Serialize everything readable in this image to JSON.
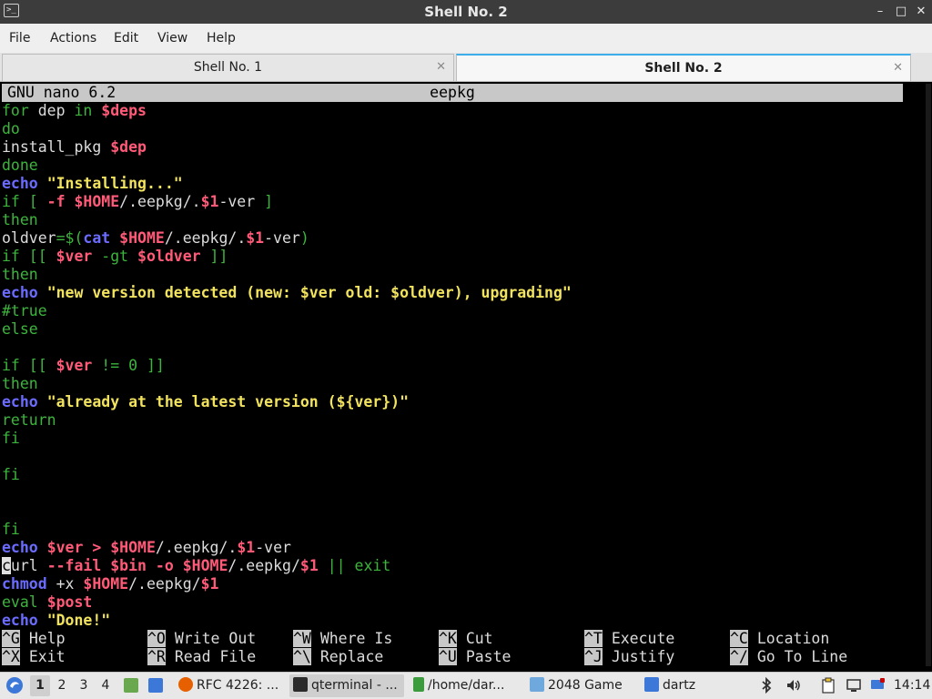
{
  "window": {
    "title": "Shell No. 2",
    "controls": {
      "minimize": "–",
      "maximize": "□",
      "close": "✕"
    }
  },
  "menu": [
    "File",
    "Actions",
    "Edit",
    "View",
    "Help"
  ],
  "tabs": [
    {
      "label": "Shell No. 1",
      "active": false
    },
    {
      "label": "Shell No. 2",
      "active": true
    }
  ],
  "nano": {
    "version_label": "GNU nano 6.2",
    "filename": "eepkg",
    "lines": [
      [
        [
          "for",
          "kw"
        ],
        [
          " dep ",
          "plain"
        ],
        [
          "in",
          "kw"
        ],
        [
          " ",
          "plain"
        ],
        [
          "$deps",
          "var"
        ]
      ],
      [
        [
          "do",
          "kw"
        ]
      ],
      [
        [
          "install_pkg ",
          "plain"
        ],
        [
          "$dep",
          "var"
        ]
      ],
      [
        [
          "done",
          "kw"
        ]
      ],
      [
        [
          "echo",
          "blue"
        ],
        [
          " ",
          "plain"
        ],
        [
          "\"Installing...\"",
          "str"
        ]
      ],
      [
        [
          "if [ ",
          "kw"
        ],
        [
          "-f",
          "red"
        ],
        [
          " ",
          "plain"
        ],
        [
          "$HOME",
          "var"
        ],
        [
          "/.eepkg/.",
          "plain"
        ],
        [
          "$1",
          "var"
        ],
        [
          "-ver ",
          "plain"
        ],
        [
          "]",
          "kw"
        ]
      ],
      [
        [
          "then",
          "kw"
        ]
      ],
      [
        [
          "oldver",
          "plain"
        ],
        [
          "=$(",
          "kw"
        ],
        [
          "cat",
          "blue"
        ],
        [
          " ",
          "plain"
        ],
        [
          "$HOME",
          "var"
        ],
        [
          "/.eepkg/.",
          "plain"
        ],
        [
          "$1",
          "var"
        ],
        [
          "-ver",
          "plain"
        ],
        [
          ")",
          "kw"
        ]
      ],
      [
        [
          "if [[ ",
          "kw"
        ],
        [
          "$ver",
          "var"
        ],
        [
          " -gt ",
          "kw"
        ],
        [
          "$oldver",
          "var"
        ],
        [
          " ]]",
          "kw"
        ]
      ],
      [
        [
          "then",
          "kw"
        ]
      ],
      [
        [
          "echo",
          "blue"
        ],
        [
          " ",
          "plain"
        ],
        [
          "\"new version detected (new: $ver old: $oldver), upgrading\"",
          "str"
        ]
      ],
      [
        [
          "#true",
          "kw"
        ]
      ],
      [
        [
          "else",
          "kw"
        ]
      ],
      [],
      [
        [
          "if [[ ",
          "kw"
        ],
        [
          "$ver",
          "var"
        ],
        [
          " != 0 ]]",
          "kw"
        ]
      ],
      [
        [
          "then",
          "kw"
        ]
      ],
      [
        [
          "echo",
          "blue"
        ],
        [
          " ",
          "plain"
        ],
        [
          "\"already at the latest version (${ver})\"",
          "str"
        ]
      ],
      [
        [
          "return",
          "kw"
        ]
      ],
      [
        [
          "fi",
          "kw"
        ]
      ],
      [],
      [
        [
          "fi",
          "kw"
        ]
      ],
      [],
      [],
      [
        [
          "fi",
          "kw"
        ]
      ],
      [
        [
          "echo",
          "blue"
        ],
        [
          " ",
          "plain"
        ],
        [
          "$ver",
          "var"
        ],
        [
          " > ",
          "red"
        ],
        [
          "$HOME",
          "var"
        ],
        [
          "/.eepkg/.",
          "plain"
        ],
        [
          "$1",
          "var"
        ],
        [
          "-ver",
          "plain"
        ]
      ],
      [
        [
          "c",
          "cursor"
        ],
        [
          "url ",
          "plain"
        ],
        [
          "--fail",
          "red"
        ],
        [
          " ",
          "plain"
        ],
        [
          "$bin",
          "var"
        ],
        [
          " ",
          "plain"
        ],
        [
          "-o",
          "red"
        ],
        [
          " ",
          "plain"
        ],
        [
          "$HOME",
          "var"
        ],
        [
          "/.eepkg/",
          "plain"
        ],
        [
          "$1",
          "var"
        ],
        [
          " || ",
          "kw"
        ],
        [
          "exit",
          "kw"
        ]
      ],
      [
        [
          "chmod",
          "blue"
        ],
        [
          " +x ",
          "plain"
        ],
        [
          "$HOME",
          "var"
        ],
        [
          "/.eepkg/",
          "plain"
        ],
        [
          "$1",
          "var"
        ]
      ],
      [
        [
          "eval",
          "kw"
        ],
        [
          " ",
          "plain"
        ],
        [
          "$post",
          "var"
        ]
      ],
      [
        [
          "echo",
          "blue"
        ],
        [
          " ",
          "plain"
        ],
        [
          "\"Done!\"",
          "str"
        ]
      ]
    ],
    "shortcuts": [
      {
        "key": "^G",
        "label": "Help"
      },
      {
        "key": "^O",
        "label": "Write Out"
      },
      {
        "key": "^W",
        "label": "Where Is"
      },
      {
        "key": "^K",
        "label": "Cut"
      },
      {
        "key": "^T",
        "label": "Execute"
      },
      {
        "key": "^C",
        "label": "Location"
      },
      {
        "key": "^X",
        "label": "Exit"
      },
      {
        "key": "^R",
        "label": "Read File"
      },
      {
        "key": "^\\",
        "label": "Replace"
      },
      {
        "key": "^U",
        "label": "Paste"
      },
      {
        "key": "^J",
        "label": "Justify"
      },
      {
        "key": "^/",
        "label": "Go To Line"
      }
    ]
  },
  "taskbar": {
    "workspaces": [
      "1",
      "2",
      "3",
      "4"
    ],
    "active_workspace": "1",
    "tasks": [
      {
        "label": "RFC 4226: ...",
        "icon": "firefox-icon",
        "color": "#e66000",
        "active": false
      },
      {
        "label": "qterminal - ...",
        "icon": "terminal-icon",
        "color": "#2b2b2b",
        "active": true
      },
      {
        "label": "/home/dar...",
        "icon": "file-manager-icon",
        "color": "#3c9b3c",
        "active": false
      },
      {
        "label": "2048 Game",
        "icon": "window-icon",
        "color": "#6fa8dc",
        "active": false
      },
      {
        "label": "dartz",
        "icon": "folder-icon",
        "color": "#3c78d8",
        "active": false
      }
    ],
    "clock": "14:14"
  },
  "colors": {
    "keyword": "#3db53d",
    "command": "#6b6bff",
    "variable": "#ff5a78",
    "string": "#f2e35e",
    "accent": "#3daee9"
  }
}
